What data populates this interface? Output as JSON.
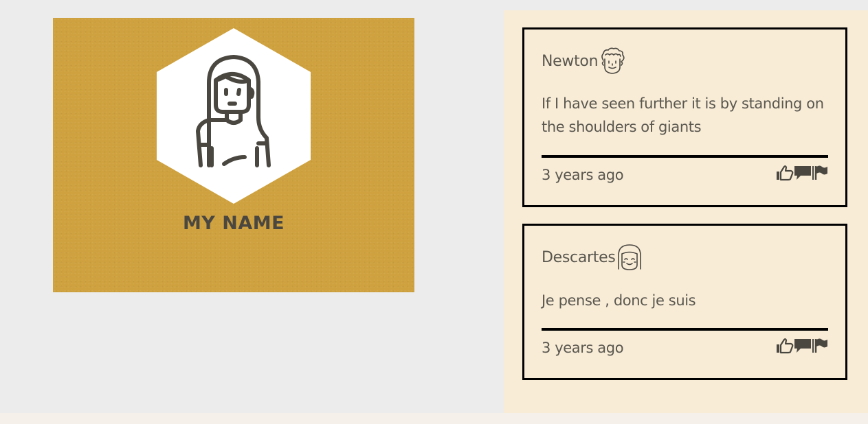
{
  "profile": {
    "name": "MY NAME",
    "avatar_icon": "woman-avatar-icon",
    "card_color": "#cfa23f"
  },
  "comments": [
    {
      "author": "Newton",
      "avatar_icon": "curly-hair-face-icon",
      "text": "If I have seen further it is by standing on the shoulders of giants",
      "time": "3 years ago",
      "actions": [
        "thumbs-up-icon",
        "comment-icon",
        "flag-icon"
      ]
    },
    {
      "author": "Descartes",
      "avatar_icon": "bob-hair-face-icon",
      "text": "Je pense , donc je suis",
      "time": "3 years ago",
      "actions": [
        "thumbs-up-icon",
        "comment-icon",
        "flag-icon"
      ]
    }
  ]
}
